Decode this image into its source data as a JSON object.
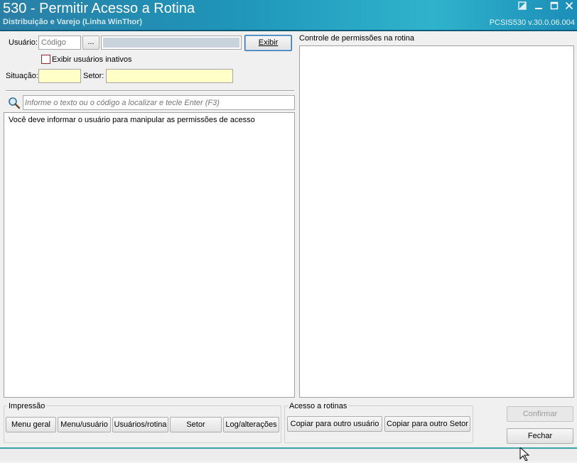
{
  "header": {
    "title": "530 - Permitir Acesso a Rotina",
    "subtitle": "Distribuição e Varejo (Linha WinThor)",
    "version": "PCSIS530  v.30.0.06.004"
  },
  "window_controls": {
    "restore_icon": "restore-icon",
    "minimize_icon": "minimize-icon",
    "maximize_icon": "maximize-icon",
    "close_icon": "close-icon"
  },
  "form": {
    "usuario_label": "Usuário:",
    "codigo_placeholder": "Código",
    "ellipsis_label": "...",
    "exibir_button": "Exibir",
    "inactive_checkbox_label": "Exibir usuários inativos",
    "situacao_label": "Situação:",
    "setor_label": "Setor:"
  },
  "search": {
    "icon": "search-icon",
    "placeholder": "Informe o texto ou o código a localizar e tecle Enter (F3)"
  },
  "list": {
    "message": "Você deve informar o usuário para manipular as permissões de acesso"
  },
  "permissions": {
    "title": "Controle de permissões na rotina"
  },
  "impressao": {
    "title": "Impressão",
    "buttons": [
      "Menu geral",
      "Menu/usuário",
      "Usuários/rotina",
      "Setor",
      "Log/alterações"
    ]
  },
  "acesso": {
    "title": "Acesso a rotinas",
    "buttons": [
      "Copiar para outro usuário",
      "Copiar para outro Setor"
    ]
  },
  "actions": {
    "confirmar": "Confirmar",
    "fechar": "Fechar"
  }
}
